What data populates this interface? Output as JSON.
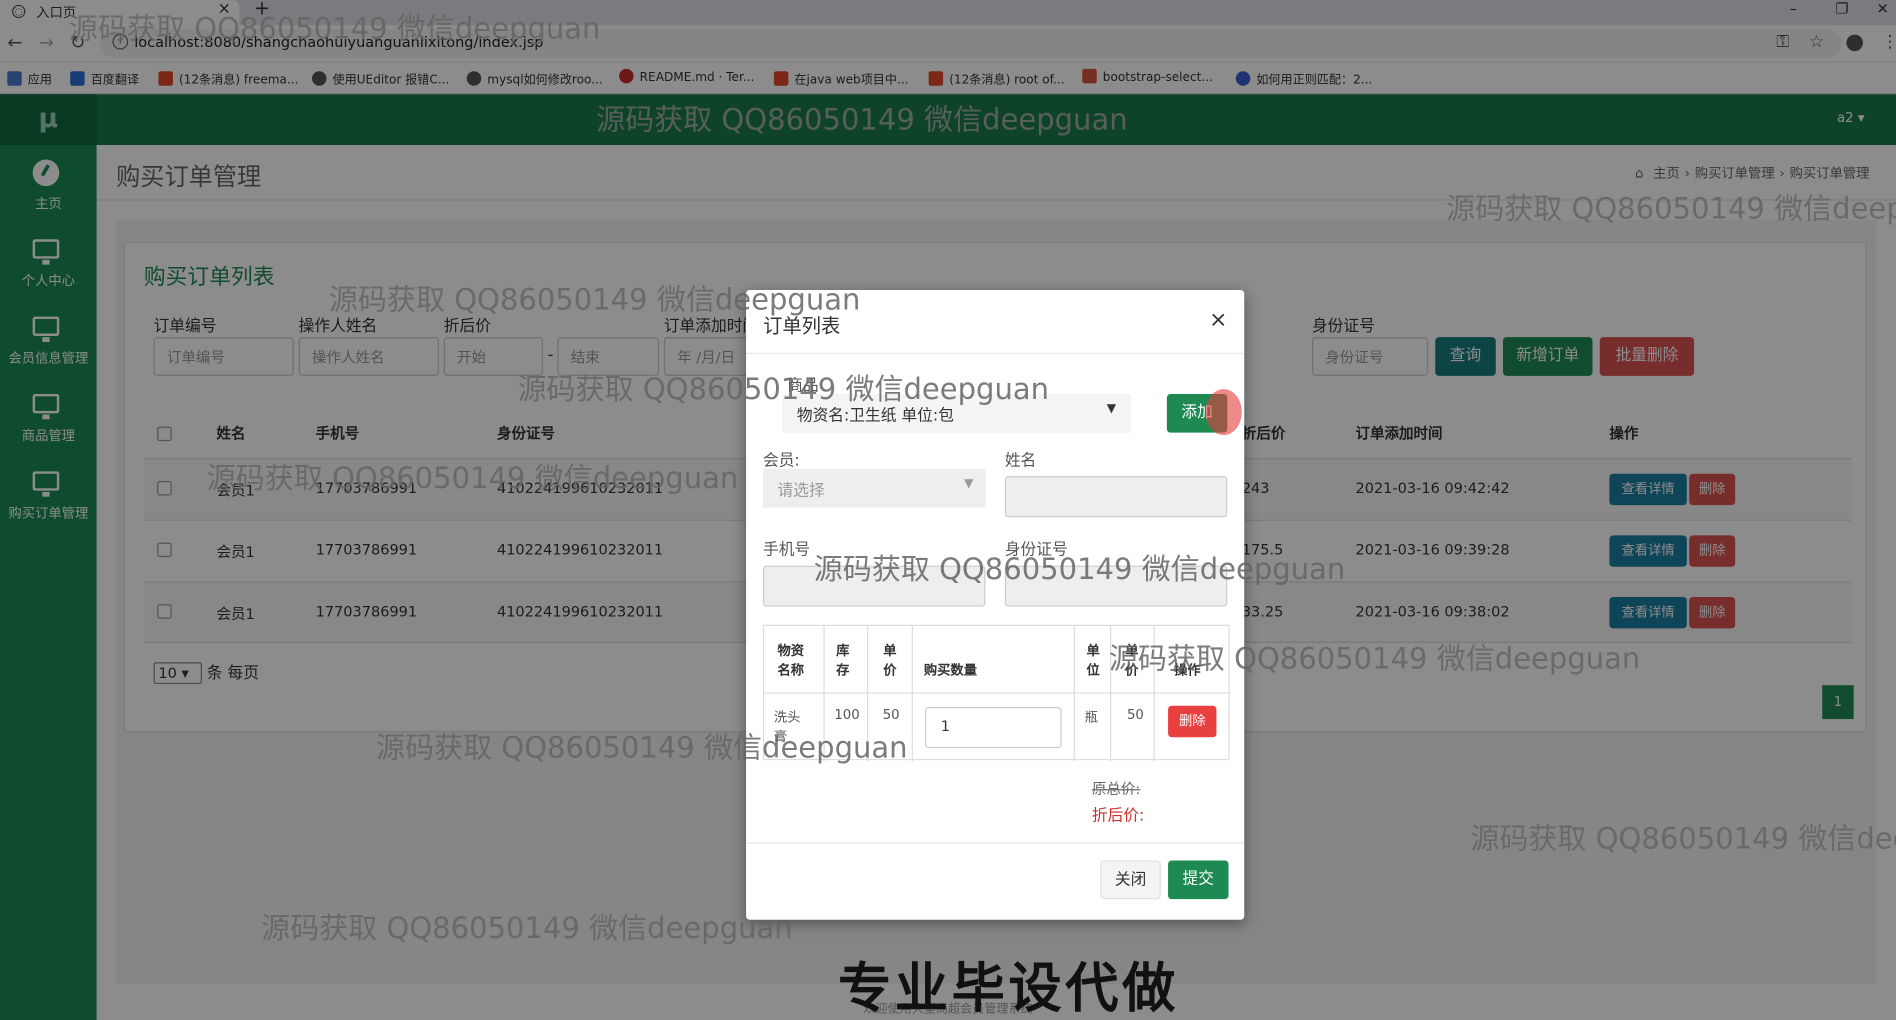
{
  "browser": {
    "tab_title": "入口页",
    "url": "localhost:8080/shangchaohuiyuanguanlixitong/index.jsp",
    "bookmarks": [
      "应用",
      "百度翻译",
      "(12条消息) freema...",
      "使用UEditor 报错C...",
      "mysql如何修改roo...",
      "README.md · Ter...",
      "在java web项目中...",
      "(12条消息) root of...",
      "bootstrap-select...",
      "如何用正则匹配：2..."
    ]
  },
  "app": {
    "logo": "μ",
    "user": "a2 ▾",
    "sidebar": [
      "主页",
      "个人中心",
      "会员信息管理",
      "商品管理",
      "购买订单管理"
    ],
    "page_title": "购买订单管理",
    "breadcrumb": [
      "主页",
      "购买订单管理",
      "购买订单管理"
    ],
    "panel_title": "购买订单列表",
    "filters": {
      "labels": [
        "订单编号",
        "操作人姓名",
        "折后价",
        "订单添加时间",
        "身份证号"
      ],
      "placeholders": [
        "订单编号",
        "操作人姓名",
        "开始",
        "结束",
        "年 /月/日",
        "身份证号"
      ],
      "dash": "-"
    },
    "buttons": {
      "query": "查询",
      "add": "新增订单",
      "batch_delete": "批量删除"
    },
    "table": {
      "headers": [
        "姓名",
        "手机号",
        "身份证号",
        "折后价",
        "订单添加时间",
        "操作"
      ],
      "rows": [
        {
          "name": "会员1",
          "phone": "17703786991",
          "id": "410224199610232011",
          "price": "243",
          "time": "2021-03-16 09:42:42"
        },
        {
          "name": "会员1",
          "phone": "17703786991",
          "id": "410224199610232011",
          "price": "175.5",
          "time": "2021-03-16 09:39:28"
        },
        {
          "name": "会员1",
          "phone": "17703786991",
          "id": "410224199610232011",
          "price": "33.25",
          "time": "2021-03-16 09:38:02"
        }
      ],
      "view_label": "查看详情",
      "delete_label": "删除"
    },
    "per_page_value": "10",
    "per_page_text": "条 每页",
    "page_number": "1",
    "footer": "欢迎使用大型商超会员管理系统"
  },
  "modal": {
    "title": "订单列表",
    "close_icon": "×",
    "goods_label": "商品",
    "goods_value": "物资名:卫生纸 单位:包",
    "add_button": "添加",
    "member_label": "会员:",
    "member_placeholder": "请选择",
    "name_label": "姓名",
    "phone_label": "手机号",
    "idcard_label": "身份证号",
    "items_headers": [
      "物资名称",
      "库存",
      "单价",
      "购买数量",
      "单位",
      "单价",
      "操作"
    ],
    "item": {
      "name": "洗头膏",
      "stock": "100",
      "price": "50",
      "qty": "1",
      "unit": "瓶",
      "subtotal": "50",
      "delete": "删除"
    },
    "orig_total_label": "原总价:",
    "disc_total_label": "折后价:",
    "close_button": "关闭",
    "submit_button": "提交"
  },
  "watermarks": {
    "text": "源码获取 QQ86050149 微信deepguan",
    "banner": "专业毕设代做"
  }
}
